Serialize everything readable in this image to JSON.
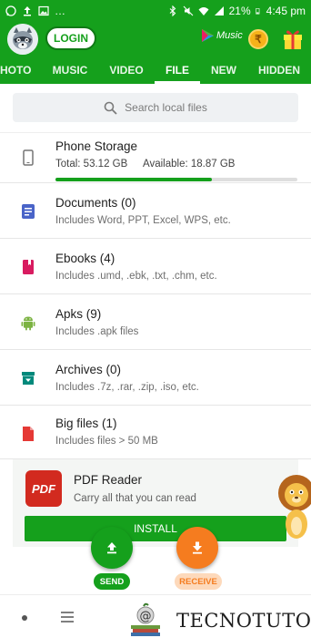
{
  "status_bar": {
    "time": "4:45 pm",
    "battery": "21%",
    "left_icons": [
      "whatsapp-icon",
      "upload-icon",
      "image-icon",
      "more-icon"
    ],
    "right_icons": [
      "bluetooth-icon",
      "mute-icon",
      "wifi-icon",
      "signal-icon",
      "battery-icon"
    ]
  },
  "header": {
    "login_label": "LOGIN",
    "music_label": "Music"
  },
  "tabs": [
    {
      "label": "HOTO",
      "active": false
    },
    {
      "label": "MUSIC",
      "active": false
    },
    {
      "label": "VIDEO",
      "active": false
    },
    {
      "label": "FILE",
      "active": true
    },
    {
      "label": "NEW",
      "active": false
    },
    {
      "label": "HIDDEN",
      "active": false
    }
  ],
  "search": {
    "placeholder": "Search local files"
  },
  "storage": {
    "title": "Phone Storage",
    "total": "Total: 53.12 GB",
    "available": "Available: 18.87 GB",
    "used_fraction": 0.645
  },
  "categories": [
    {
      "title": "Documents (0)",
      "subtitle": "Includes Word, PPT, Excel, WPS, etc.",
      "icon": "document-icon",
      "color": "#4a64c8"
    },
    {
      "title": "Ebooks (4)",
      "subtitle": "Includes .umd, .ebk, .txt, .chm, etc.",
      "icon": "ebook-icon",
      "color": "#d81b60"
    },
    {
      "title": "Apks (9)",
      "subtitle": "Includes .apk files",
      "icon": "android-icon",
      "color": "#7cb342"
    },
    {
      "title": "Archives (0)",
      "subtitle": "Includes .7z, .rar, .zip, .iso, etc.",
      "icon": "archive-icon",
      "color": "#00897b"
    },
    {
      "title": "Big files (1)",
      "subtitle": "Includes files > 50 MB",
      "icon": "big-file-icon",
      "color": "#e53935"
    }
  ],
  "ad": {
    "logo_text": "PDF",
    "title": "PDF Reader",
    "subtitle": "Carry all that you can read",
    "install_label": "INSTALL"
  },
  "actions": {
    "send_label": "SEND",
    "receive_label": "RECEIVE"
  },
  "watermark": {
    "text": "TECNOTUTO"
  },
  "colors": {
    "brand_green": "#15a01c",
    "receive_orange": "#f57c1f"
  }
}
